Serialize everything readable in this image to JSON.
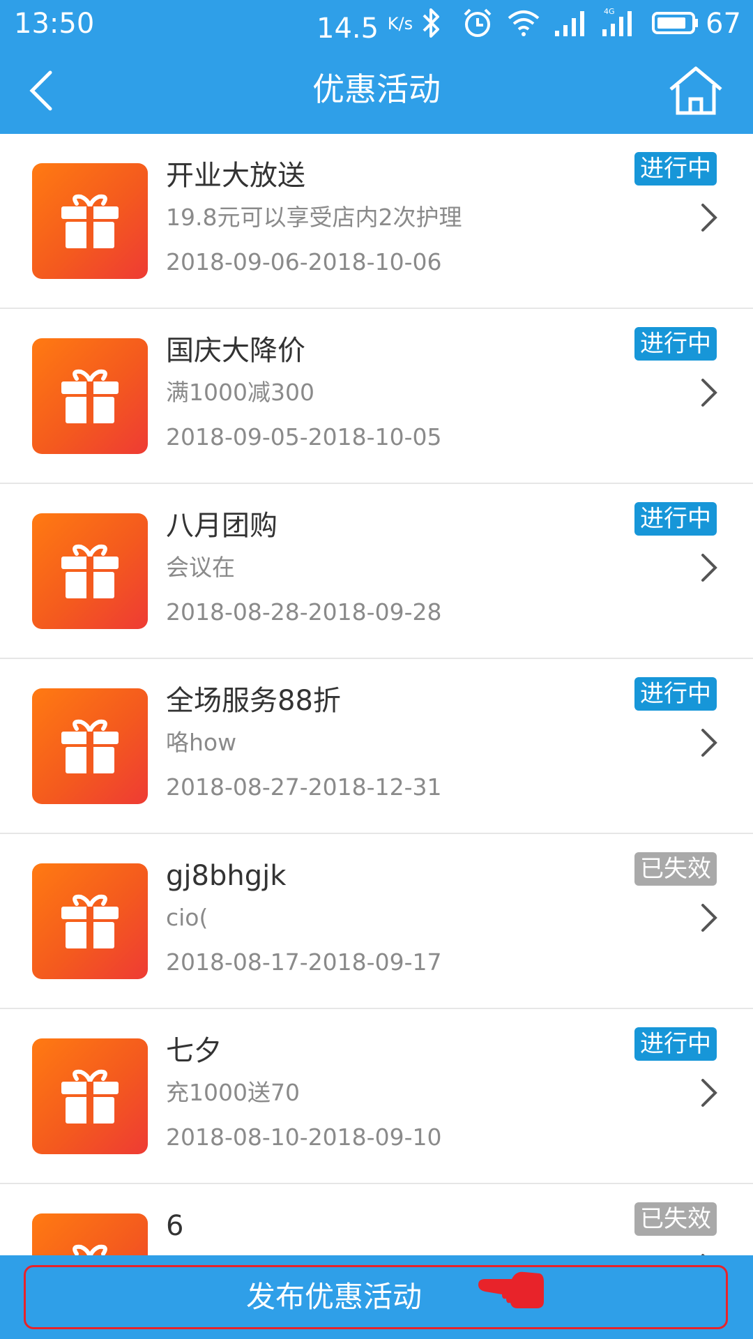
{
  "status_bar": {
    "time": "13:50",
    "speed_value": "14.5",
    "speed_unit": "K/s",
    "battery": "67",
    "icons": [
      "bluetooth-icon",
      "alarm-icon",
      "wifi-icon",
      "signal-icon",
      "signal-4g-icon",
      "battery-icon"
    ]
  },
  "header": {
    "title": "优惠活动",
    "back_icon": "chevron-left-icon",
    "home_icon": "home-icon"
  },
  "colors": {
    "primary": "#2f9fe8",
    "badge_active": "#1796d8",
    "badge_expired": "#a9a9a9",
    "thumb_gradient_start": "#ff7a12",
    "thumb_gradient_end": "#ee3b34",
    "highlight": "#e8232a"
  },
  "activities": [
    {
      "name": "开业大放送",
      "desc": "19.8元可以享受店内2次护理",
      "date": "2018-09-06-2018-10-06",
      "status": "进行中"
    },
    {
      "name": "国庆大降价",
      "desc": "满1000减300",
      "date": "2018-09-05-2018-10-05",
      "status": "进行中"
    },
    {
      "name": "八月团购",
      "desc": "会议在",
      "date": "2018-08-28-2018-09-28",
      "status": "进行中"
    },
    {
      "name": "全场服务88折",
      "desc": "咯how",
      "date": "2018-08-27-2018-12-31",
      "status": "进行中"
    },
    {
      "name": "gj8bhgjk",
      "desc": "cio(",
      "date": "2018-08-17-2018-09-17",
      "status": "已失效"
    },
    {
      "name": "七夕",
      "desc": "充1000送70",
      "date": "2018-08-10-2018-09-10",
      "status": "进行中"
    },
    {
      "name": "6",
      "desc": "",
      "date": "",
      "status": "已失效"
    }
  ],
  "footer": {
    "publish_label": "发布优惠活动",
    "pointer_icon": "pointing-hand-icon"
  }
}
